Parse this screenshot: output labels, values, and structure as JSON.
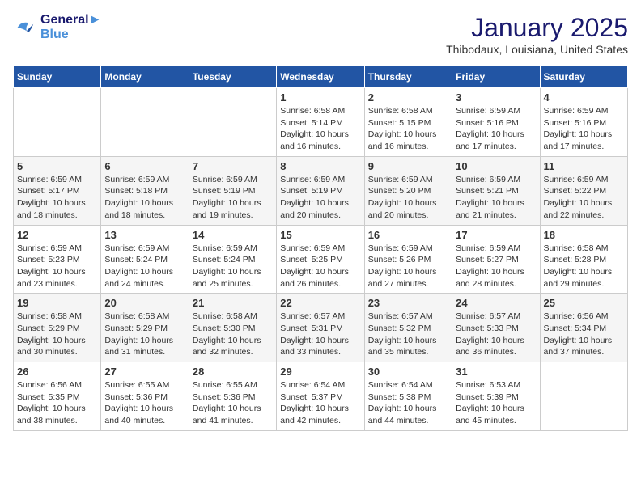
{
  "header": {
    "logo_line1": "General",
    "logo_line2": "Blue",
    "month": "January 2025",
    "location": "Thibodaux, Louisiana, United States"
  },
  "days_of_week": [
    "Sunday",
    "Monday",
    "Tuesday",
    "Wednesday",
    "Thursday",
    "Friday",
    "Saturday"
  ],
  "weeks": [
    [
      {
        "day": "",
        "sunrise": "",
        "sunset": "",
        "daylight": ""
      },
      {
        "day": "",
        "sunrise": "",
        "sunset": "",
        "daylight": ""
      },
      {
        "day": "",
        "sunrise": "",
        "sunset": "",
        "daylight": ""
      },
      {
        "day": "1",
        "sunrise": "Sunrise: 6:58 AM",
        "sunset": "Sunset: 5:14 PM",
        "daylight": "Daylight: 10 hours and 16 minutes."
      },
      {
        "day": "2",
        "sunrise": "Sunrise: 6:58 AM",
        "sunset": "Sunset: 5:15 PM",
        "daylight": "Daylight: 10 hours and 16 minutes."
      },
      {
        "day": "3",
        "sunrise": "Sunrise: 6:59 AM",
        "sunset": "Sunset: 5:16 PM",
        "daylight": "Daylight: 10 hours and 17 minutes."
      },
      {
        "day": "4",
        "sunrise": "Sunrise: 6:59 AM",
        "sunset": "Sunset: 5:16 PM",
        "daylight": "Daylight: 10 hours and 17 minutes."
      }
    ],
    [
      {
        "day": "5",
        "sunrise": "Sunrise: 6:59 AM",
        "sunset": "Sunset: 5:17 PM",
        "daylight": "Daylight: 10 hours and 18 minutes."
      },
      {
        "day": "6",
        "sunrise": "Sunrise: 6:59 AM",
        "sunset": "Sunset: 5:18 PM",
        "daylight": "Daylight: 10 hours and 18 minutes."
      },
      {
        "day": "7",
        "sunrise": "Sunrise: 6:59 AM",
        "sunset": "Sunset: 5:19 PM",
        "daylight": "Daylight: 10 hours and 19 minutes."
      },
      {
        "day": "8",
        "sunrise": "Sunrise: 6:59 AM",
        "sunset": "Sunset: 5:19 PM",
        "daylight": "Daylight: 10 hours and 20 minutes."
      },
      {
        "day": "9",
        "sunrise": "Sunrise: 6:59 AM",
        "sunset": "Sunset: 5:20 PM",
        "daylight": "Daylight: 10 hours and 20 minutes."
      },
      {
        "day": "10",
        "sunrise": "Sunrise: 6:59 AM",
        "sunset": "Sunset: 5:21 PM",
        "daylight": "Daylight: 10 hours and 21 minutes."
      },
      {
        "day": "11",
        "sunrise": "Sunrise: 6:59 AM",
        "sunset": "Sunset: 5:22 PM",
        "daylight": "Daylight: 10 hours and 22 minutes."
      }
    ],
    [
      {
        "day": "12",
        "sunrise": "Sunrise: 6:59 AM",
        "sunset": "Sunset: 5:23 PM",
        "daylight": "Daylight: 10 hours and 23 minutes."
      },
      {
        "day": "13",
        "sunrise": "Sunrise: 6:59 AM",
        "sunset": "Sunset: 5:24 PM",
        "daylight": "Daylight: 10 hours and 24 minutes."
      },
      {
        "day": "14",
        "sunrise": "Sunrise: 6:59 AM",
        "sunset": "Sunset: 5:24 PM",
        "daylight": "Daylight: 10 hours and 25 minutes."
      },
      {
        "day": "15",
        "sunrise": "Sunrise: 6:59 AM",
        "sunset": "Sunset: 5:25 PM",
        "daylight": "Daylight: 10 hours and 26 minutes."
      },
      {
        "day": "16",
        "sunrise": "Sunrise: 6:59 AM",
        "sunset": "Sunset: 5:26 PM",
        "daylight": "Daylight: 10 hours and 27 minutes."
      },
      {
        "day": "17",
        "sunrise": "Sunrise: 6:59 AM",
        "sunset": "Sunset: 5:27 PM",
        "daylight": "Daylight: 10 hours and 28 minutes."
      },
      {
        "day": "18",
        "sunrise": "Sunrise: 6:58 AM",
        "sunset": "Sunset: 5:28 PM",
        "daylight": "Daylight: 10 hours and 29 minutes."
      }
    ],
    [
      {
        "day": "19",
        "sunrise": "Sunrise: 6:58 AM",
        "sunset": "Sunset: 5:29 PM",
        "daylight": "Daylight: 10 hours and 30 minutes."
      },
      {
        "day": "20",
        "sunrise": "Sunrise: 6:58 AM",
        "sunset": "Sunset: 5:29 PM",
        "daylight": "Daylight: 10 hours and 31 minutes."
      },
      {
        "day": "21",
        "sunrise": "Sunrise: 6:58 AM",
        "sunset": "Sunset: 5:30 PM",
        "daylight": "Daylight: 10 hours and 32 minutes."
      },
      {
        "day": "22",
        "sunrise": "Sunrise: 6:57 AM",
        "sunset": "Sunset: 5:31 PM",
        "daylight": "Daylight: 10 hours and 33 minutes."
      },
      {
        "day": "23",
        "sunrise": "Sunrise: 6:57 AM",
        "sunset": "Sunset: 5:32 PM",
        "daylight": "Daylight: 10 hours and 35 minutes."
      },
      {
        "day": "24",
        "sunrise": "Sunrise: 6:57 AM",
        "sunset": "Sunset: 5:33 PM",
        "daylight": "Daylight: 10 hours and 36 minutes."
      },
      {
        "day": "25",
        "sunrise": "Sunrise: 6:56 AM",
        "sunset": "Sunset: 5:34 PM",
        "daylight": "Daylight: 10 hours and 37 minutes."
      }
    ],
    [
      {
        "day": "26",
        "sunrise": "Sunrise: 6:56 AM",
        "sunset": "Sunset: 5:35 PM",
        "daylight": "Daylight: 10 hours and 38 minutes."
      },
      {
        "day": "27",
        "sunrise": "Sunrise: 6:55 AM",
        "sunset": "Sunset: 5:36 PM",
        "daylight": "Daylight: 10 hours and 40 minutes."
      },
      {
        "day": "28",
        "sunrise": "Sunrise: 6:55 AM",
        "sunset": "Sunset: 5:36 PM",
        "daylight": "Daylight: 10 hours and 41 minutes."
      },
      {
        "day": "29",
        "sunrise": "Sunrise: 6:54 AM",
        "sunset": "Sunset: 5:37 PM",
        "daylight": "Daylight: 10 hours and 42 minutes."
      },
      {
        "day": "30",
        "sunrise": "Sunrise: 6:54 AM",
        "sunset": "Sunset: 5:38 PM",
        "daylight": "Daylight: 10 hours and 44 minutes."
      },
      {
        "day": "31",
        "sunrise": "Sunrise: 6:53 AM",
        "sunset": "Sunset: 5:39 PM",
        "daylight": "Daylight: 10 hours and 45 minutes."
      },
      {
        "day": "",
        "sunrise": "",
        "sunset": "",
        "daylight": ""
      }
    ]
  ]
}
